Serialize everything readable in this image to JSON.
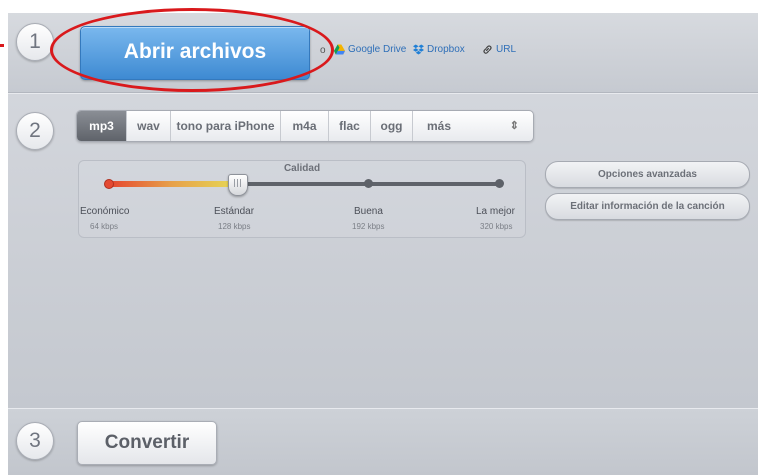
{
  "steps": {
    "one": "1",
    "two": "2",
    "three": "3"
  },
  "open": {
    "label": "Abrir archivos",
    "or": "o"
  },
  "sources": {
    "gdrive": "Google Drive",
    "dropbox": "Dropbox",
    "url": "URL"
  },
  "formats": {
    "tabs": [
      "mp3",
      "wav",
      "tono para iPhone",
      "m4a",
      "flac",
      "ogg",
      "más"
    ],
    "selected": "mp3"
  },
  "quality": {
    "title": "Calidad",
    "levels": [
      {
        "label": "Económico",
        "rate": "64 kbps"
      },
      {
        "label": "Estándar",
        "rate": "128 kbps"
      },
      {
        "label": "Buena",
        "rate": "192 kbps"
      },
      {
        "label": "La mejor",
        "rate": "320 kbps"
      }
    ],
    "selected_index": 1
  },
  "side": {
    "advanced": "Opciones avanzadas",
    "edit_info": "Editar información de la canción"
  },
  "convert": {
    "label": "Convertir"
  },
  "colors": {
    "primary": "#4a94db",
    "highlight_ring": "#d9191c",
    "link": "#2f6fb8"
  }
}
